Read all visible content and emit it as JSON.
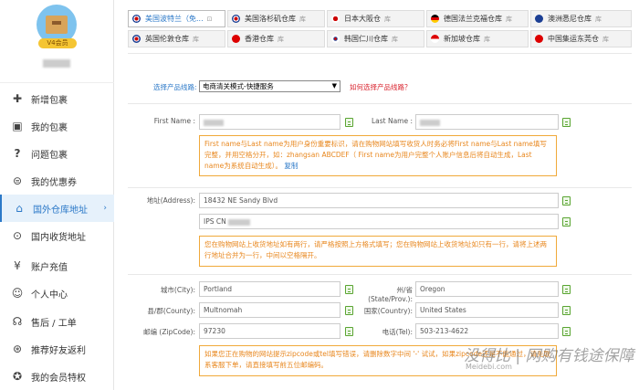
{
  "sidebar": {
    "vip_badge": "V4会员",
    "items": [
      {
        "label": "新增包裹",
        "icon": "plus-icon"
      },
      {
        "label": "我的包裹",
        "icon": "gift-icon"
      },
      {
        "label": "问题包裹",
        "icon": "question-icon"
      },
      {
        "label": "我的优惠券",
        "icon": "coupon-icon"
      },
      {
        "label": "国外仓库地址",
        "icon": "house-icon",
        "active": true
      },
      {
        "label": "国内收货地址",
        "icon": "location-pin-icon"
      },
      {
        "label": "账户充值",
        "icon": "yen-icon"
      },
      {
        "label": "个人中心",
        "icon": "user-icon"
      },
      {
        "label": "售后 / 工单",
        "icon": "headset-icon"
      },
      {
        "label": "推荐好友返利",
        "icon": "share-icon"
      },
      {
        "label": "我的会员特权",
        "icon": "medal-icon"
      }
    ]
  },
  "warehouse_tabs": [
    {
      "label": "美国波特兰（免...",
      "flag": "us-flag",
      "active": true
    },
    {
      "label": "美国洛杉矶仓库",
      "flag": "us-flag"
    },
    {
      "label": "日本大阪仓",
      "flag": "jp-flag"
    },
    {
      "label": "德国法兰克福仓库",
      "flag": "de-flag"
    },
    {
      "label": "澳洲悉尼仓库",
      "flag": "au-flag"
    },
    {
      "label": "英国伦敦仓库",
      "flag": "uk-flag"
    },
    {
      "label": "香港仓库",
      "flag": "hk-flag"
    },
    {
      "label": "韩国仁川仓库",
      "flag": "kr-flag"
    },
    {
      "label": "新加坡仓库",
      "flag": "sg-flag"
    },
    {
      "label": "中国集运东莞仓",
      "flag": "cn-flag"
    }
  ],
  "tab_suffix": "库",
  "route": {
    "label": "选择产品线路:",
    "selected": "电商清关模式-快捷服务",
    "help": "如何选择产品线路？"
  },
  "form": {
    "first_name_label": "First Name :",
    "last_name_label": "Last Name :",
    "name_note": "First name与Last name为用户身份重要标识，请在购物网站填写收货人时务必将First name与Last name填写完整，并用空格分开，如：zhangsan ABCDEF（ First name为用户完整个人账户信息后将自动生成，Last name为系统自动生成）。",
    "copy_link": "复制",
    "address_label": "地址(Address):",
    "address1": "18432 NE Sandy Blvd",
    "address2": "IPS CN",
    "address_note": "您在购物网站上收货地址如有两行，请严格按照上方格式填写；您在购物网站上收货地址如只有一行，请将上述两行地址合并为一行，中间以空格隔开。",
    "city_label": "城市(City):",
    "city": "Portland",
    "state_label": "州/省(State/Prov.):",
    "state": "Oregon",
    "county_label": "县/郡(County):",
    "county": "Multnomah",
    "country_label": "国家(Country):",
    "country": "United States",
    "zip_label": "邮编 (ZipCode):",
    "zip": "97230",
    "tel_label": "电话(Tel):",
    "tel": "503-213-4622",
    "zip_note": "如果您正在购物的网站提示zipcode或tel填写错误，请删除数字中间 '-' 试试，如果zipcode还是不能通过，请先联系客服下单，请直接填写前五位邮编码。"
  },
  "watermark": "没得比 | 网购有钱途保障",
  "watermark_sub": "Meidebi.com"
}
